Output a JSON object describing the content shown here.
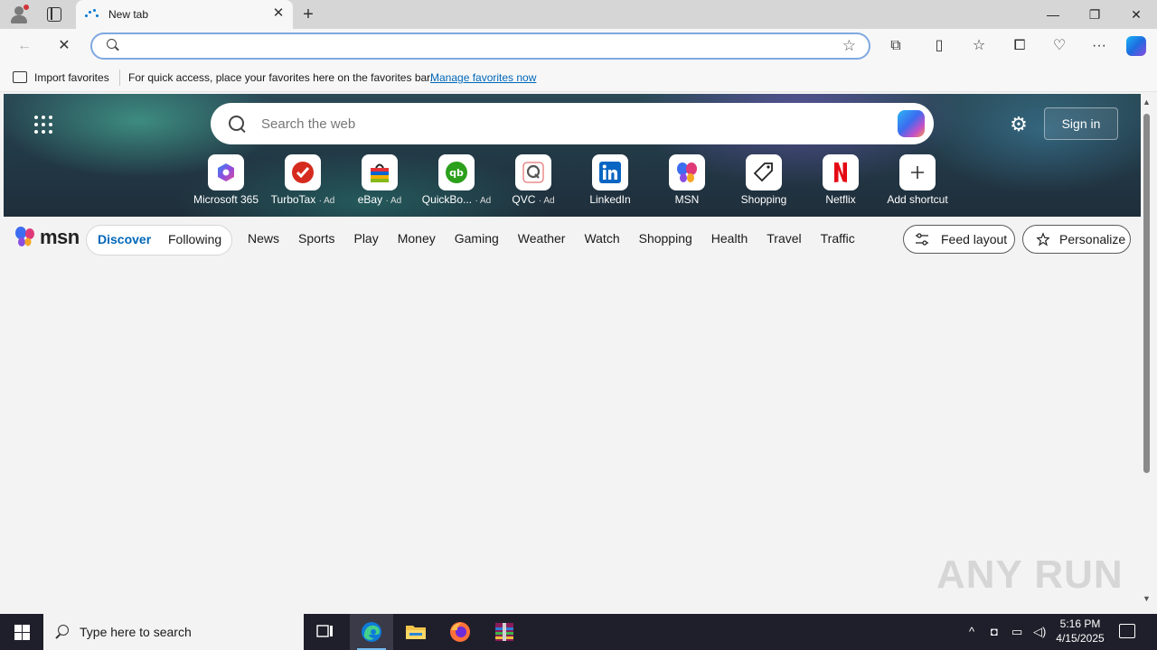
{
  "tab": {
    "title": "New tab"
  },
  "favorites_bar": {
    "import_label": "Import favorites",
    "message": "For quick access, place your favorites here on the favorites bar.",
    "manage_link": "Manage favorites now"
  },
  "search": {
    "placeholder": "Search the web"
  },
  "header": {
    "signin_label": "Sign in"
  },
  "shortcuts": [
    {
      "label": "Microsoft 365",
      "ad": ""
    },
    {
      "label": "TurboTax",
      "ad": "· Ad"
    },
    {
      "label": "eBay",
      "ad": "· Ad"
    },
    {
      "label": "QuickBo...",
      "ad": "· Ad"
    },
    {
      "label": "QVC",
      "ad": "· Ad"
    },
    {
      "label": "LinkedIn",
      "ad": ""
    },
    {
      "label": "MSN",
      "ad": ""
    },
    {
      "label": "Shopping",
      "ad": ""
    },
    {
      "label": "Netflix",
      "ad": ""
    },
    {
      "label": "Add shortcut",
      "ad": ""
    }
  ],
  "msn": {
    "logo_text": "msn",
    "discover": "Discover",
    "following": "Following",
    "nav": [
      "News",
      "Sports",
      "Play",
      "Money",
      "Gaming",
      "Weather",
      "Watch",
      "Shopping",
      "Health",
      "Travel",
      "Traffic"
    ],
    "feed_layout": "Feed layout",
    "personalize": "Personalize"
  },
  "watermark": "ANY RUN",
  "taskbar": {
    "search_placeholder": "Type here to search",
    "time": "5:16 PM",
    "date": "4/15/2025"
  },
  "colors": {
    "accent": "#0067b8",
    "address_border": "#7fa8e0",
    "taskbar": "#1f1f2b"
  }
}
